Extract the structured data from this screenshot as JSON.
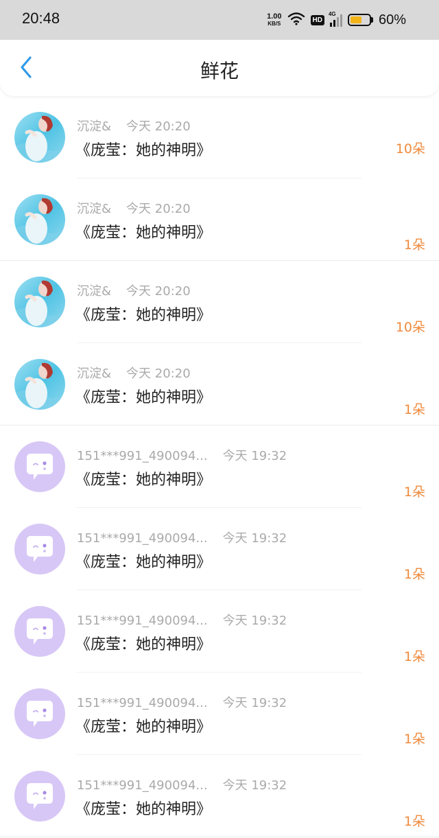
{
  "status_bar": {
    "time": "20:48",
    "net_speed_value": "1.00",
    "net_speed_unit": "KB/S",
    "hd_label": "HD",
    "network_type": "4G",
    "battery_percent": "60%",
    "battery_level": 0.6,
    "battery_color": "#f2b417"
  },
  "header": {
    "title": "鲜花",
    "back_icon": "chevron-left-icon",
    "accent_color": "#2f9ae8"
  },
  "count_color": "#f08a3c",
  "items": [
    {
      "user": "沉淀&",
      "time": "今天 20:20",
      "title": "《庞莹：她的神明》",
      "count": "10朵",
      "avatar": "photo"
    },
    {
      "user": "沉淀&",
      "time": "今天 20:20",
      "title": "《庞莹：她的神明》",
      "count": "1朵",
      "avatar": "photo"
    },
    {
      "user": "沉淀&",
      "time": "今天 20:20",
      "title": "《庞莹：她的神明》",
      "count": "10朵",
      "avatar": "photo"
    },
    {
      "user": "沉淀&",
      "time": "今天 20:20",
      "title": "《庞莹：她的神明》",
      "count": "1朵",
      "avatar": "photo"
    },
    {
      "user": "151***991_490094...",
      "time": "今天 19:32",
      "title": "《庞莹：她的神明》",
      "count": "1朵",
      "avatar": "default-chat-bubble"
    },
    {
      "user": "151***991_490094...",
      "time": "今天 19:32",
      "title": "《庞莹：她的神明》",
      "count": "1朵",
      "avatar": "default-chat-bubble"
    },
    {
      "user": "151***991_490094...",
      "time": "今天 19:32",
      "title": "《庞莹：她的神明》",
      "count": "1朵",
      "avatar": "default-chat-bubble"
    },
    {
      "user": "151***991_490094...",
      "time": "今天 19:32",
      "title": "《庞莹：她的神明》",
      "count": "1朵",
      "avatar": "default-chat-bubble"
    },
    {
      "user": "151***991_490094...",
      "time": "今天 19:32",
      "title": "《庞莹：她的神明》",
      "count": "1朵",
      "avatar": "default-chat-bubble"
    }
  ]
}
